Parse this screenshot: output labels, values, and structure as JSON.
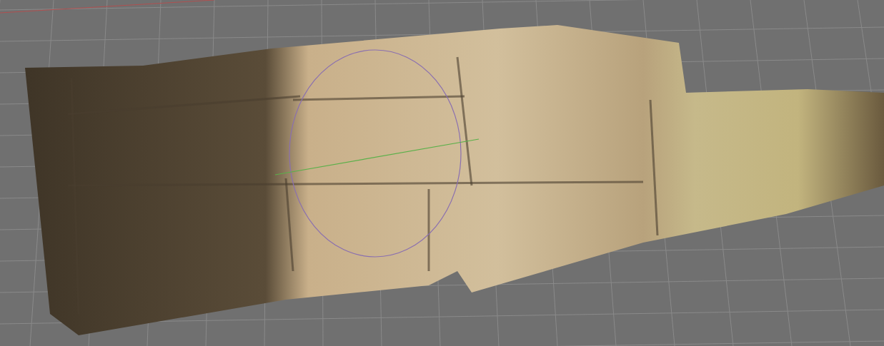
{
  "viewport": {
    "grid_visible": true,
    "gizmo_visible": true
  }
}
